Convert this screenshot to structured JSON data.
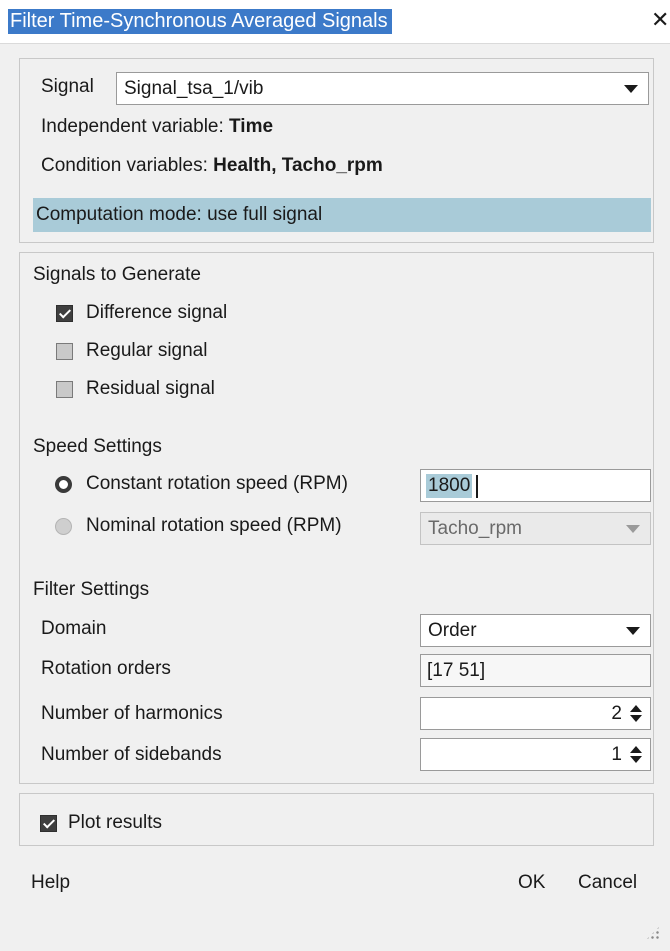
{
  "window": {
    "title": "Filter Time-Synchronous Averaged Signals",
    "close_glyph": "✕"
  },
  "signal_panel": {
    "signal_label": "Signal",
    "signal_value": "Signal_tsa_1/vib",
    "independent_label": "Independent variable:",
    "independent_value": "Time",
    "condition_label": "Condition variables:",
    "condition_value": "Health, Tacho_rpm",
    "computation_mode": "Computation mode: use full signal"
  },
  "generate": {
    "heading": "Signals to Generate",
    "options": [
      {
        "label": "Difference signal",
        "checked": true
      },
      {
        "label": "Regular signal",
        "checked": false
      },
      {
        "label": "Residual signal",
        "checked": false
      }
    ]
  },
  "speed": {
    "heading": "Speed Settings",
    "constant_label": "Constant rotation speed (RPM)",
    "constant_value": "1800",
    "nominal_label": "Nominal rotation speed (RPM)",
    "nominal_value": "Tacho_rpm",
    "selected": "constant"
  },
  "filter": {
    "heading": "Filter Settings",
    "domain_label": "Domain",
    "domain_value": "Order",
    "orders_label": "Rotation orders",
    "orders_value": "[17 51]",
    "harmonics_label": "Number of harmonics",
    "harmonics_value": "2",
    "sidebands_label": "Number of sidebands",
    "sidebands_value": "1"
  },
  "plot": {
    "label": "Plot results",
    "checked": true
  },
  "footer": {
    "help": "Help",
    "ok": "OK",
    "cancel": "Cancel"
  },
  "colors": {
    "title_highlight": "#3c7ac9",
    "selection": "#a9cbd8"
  }
}
